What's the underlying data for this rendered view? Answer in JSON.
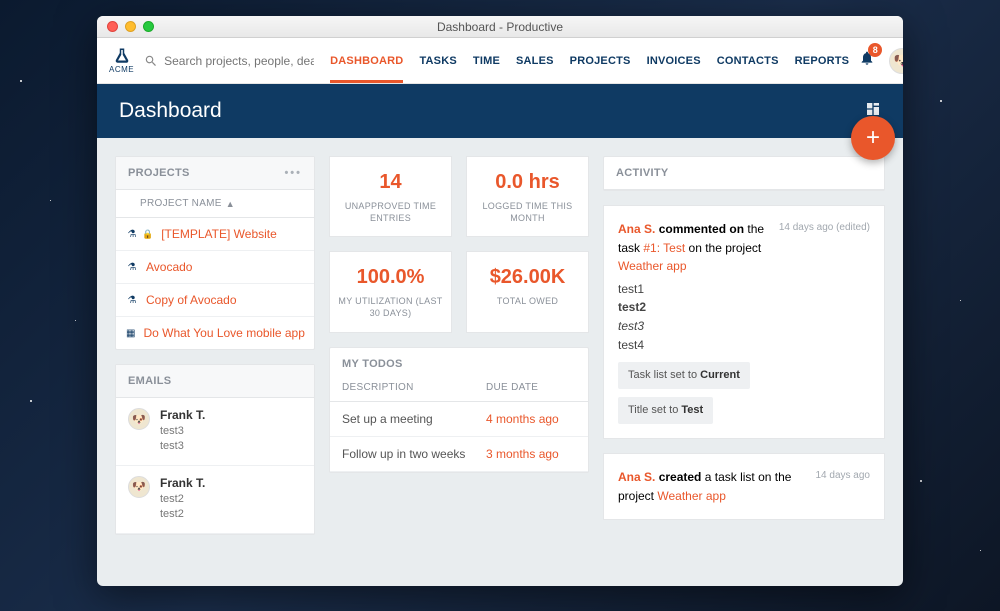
{
  "window_title": "Dashboard - Productive",
  "brand": "ACME",
  "search": {
    "placeholder": "Search projects, people, deals, co"
  },
  "nav": {
    "items": [
      "DASHBOARD",
      "TASKS",
      "TIME",
      "SALES",
      "PROJECTS",
      "INVOICES",
      "CONTACTS",
      "REPORTS"
    ],
    "active_index": 0
  },
  "notifications": {
    "count": "8"
  },
  "page_title": "Dashboard",
  "fab": "+",
  "projects": {
    "title": "PROJECTS",
    "col_label": "PROJECT NAME",
    "items": [
      {
        "name": "[TEMPLATE] Website",
        "locked": true
      },
      {
        "name": "Avocado",
        "locked": false
      },
      {
        "name": "Copy of Avocado",
        "locked": false
      },
      {
        "name": "Do What You Love mobile app",
        "locked": false
      }
    ]
  },
  "emails": {
    "title": "EMAILS",
    "rows": [
      {
        "name": "Frank T.",
        "subject": "test3",
        "preview": "test3"
      },
      {
        "name": "Frank T.",
        "subject": "test2",
        "preview": "test2"
      }
    ]
  },
  "stats": {
    "unapproved": {
      "value": "14",
      "label": "UNAPPROVED TIME ENTRIES"
    },
    "logged": {
      "value": "0.0 hrs",
      "label": "LOGGED TIME THIS MONTH"
    },
    "utilization": {
      "value": "100.0%",
      "label": "MY UTILIZATION (LAST 30 DAYS)"
    },
    "owed": {
      "value": "$26.00K",
      "label": "TOTAL OWED"
    }
  },
  "todos": {
    "title": "MY TODOS",
    "col_desc": "DESCRIPTION",
    "col_due": "DUE DATE",
    "rows": [
      {
        "desc": "Set up a meeting",
        "due": "4 months ago"
      },
      {
        "desc": "Follow up in two weeks",
        "due": "3 months ago"
      }
    ]
  },
  "activity": {
    "title": "ACTIVITY",
    "items": [
      {
        "user": "Ana S.",
        "action": "commented on",
        "context_pre": "the task",
        "task": "#1: Test",
        "context_mid": "on the project",
        "project": "Weather app",
        "time": "14 days ago (edited)",
        "comment_lines": [
          "test1",
          "test2",
          "test3",
          "test4"
        ],
        "chips": [
          {
            "pre": "Task list set to ",
            "val": "Current"
          },
          {
            "pre": "Title set to ",
            "val": "Test"
          }
        ]
      },
      {
        "user": "Ana S.",
        "action": "created",
        "context_pre": "a task list on the project",
        "project": "Weather app",
        "time": "14 days ago"
      }
    ]
  }
}
